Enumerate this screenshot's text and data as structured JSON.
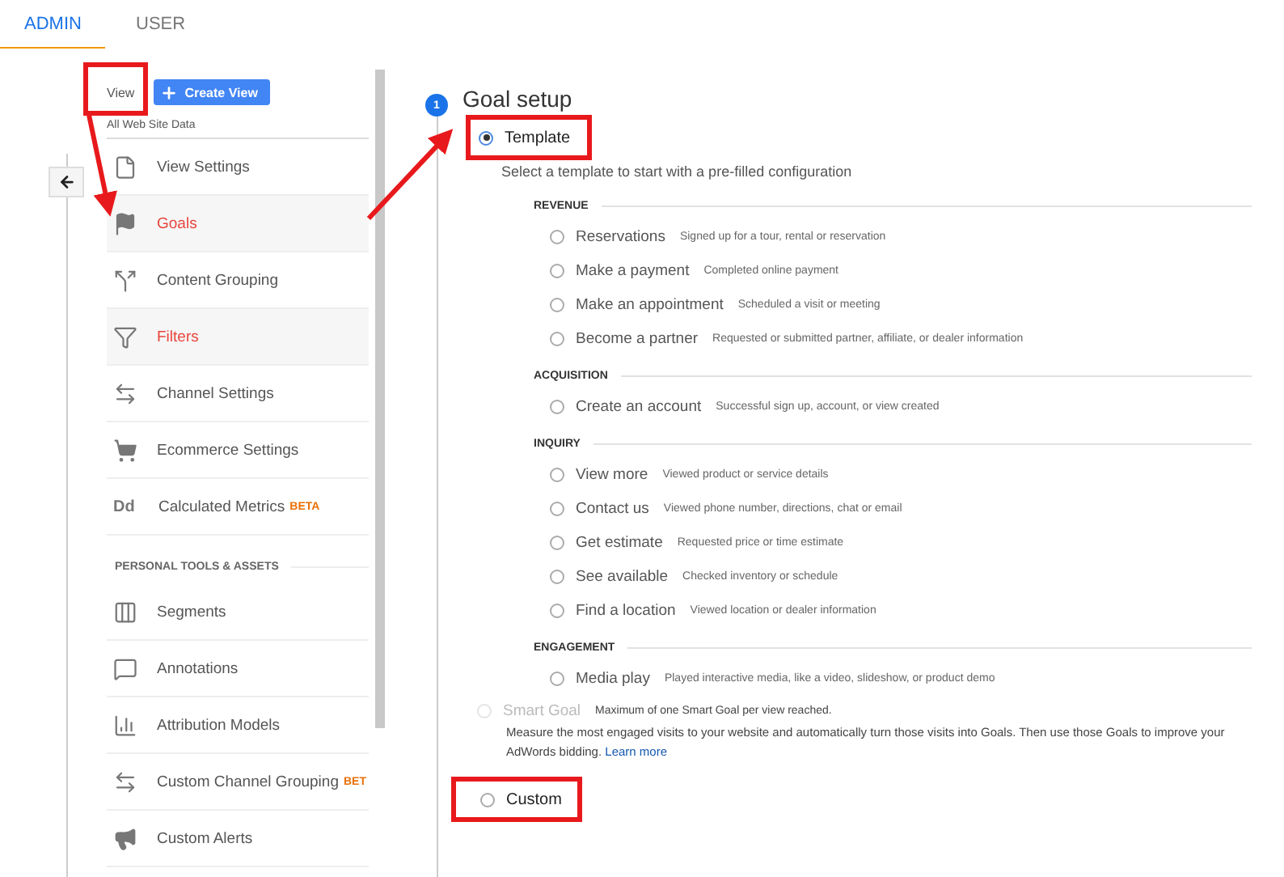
{
  "tabs": [
    {
      "label": "ADMIN",
      "selected": true
    },
    {
      "label": "USER",
      "selected": false
    }
  ],
  "view": {
    "label": "View",
    "annotated": true,
    "create_button": "Create View",
    "name": "All Web Site Data"
  },
  "menu": [
    {
      "label": "View Settings",
      "kind": "page",
      "selected": false
    },
    {
      "label": "Goals",
      "kind": "flag",
      "selected": true
    },
    {
      "label": "Content Grouping",
      "kind": "fork",
      "selected": false
    },
    {
      "label": "Filters",
      "kind": "funnel",
      "selected": true
    },
    {
      "label": "Channel Settings",
      "kind": "arrows",
      "selected": false
    },
    {
      "label": "Ecommerce Settings",
      "kind": "cart",
      "selected": false
    },
    {
      "label": "Calculated Metrics",
      "kind": "letters",
      "icon_text": "Dd",
      "badge": "BETA",
      "selected": false
    }
  ],
  "personal_section": "PERSONAL TOOLS & ASSETS",
  "personal_menu": [
    {
      "label": "Segments",
      "kind": "segments",
      "selected": false
    },
    {
      "label": "Annotations",
      "kind": "bubble",
      "selected": false
    },
    {
      "label": "Attribution Models",
      "kind": "bars",
      "selected": false
    },
    {
      "label": "Custom Channel Grouping",
      "kind": "arrows",
      "badge": "BET",
      "selected": false
    },
    {
      "label": "Custom Alerts",
      "kind": "megaphone",
      "selected": false
    }
  ],
  "goal_setup": {
    "step": "1",
    "title": "Goal setup",
    "template": {
      "label": "Template",
      "selected": true,
      "annotated": true,
      "description": "Select a template to start with a pre-filled configuration"
    },
    "groups": [
      {
        "heading": "REVENUE",
        "options": [
          {
            "label": "Reservations",
            "description": "Signed up for a tour, rental or reservation",
            "selected": false
          },
          {
            "label": "Make a payment",
            "description": "Completed online payment",
            "selected": false
          },
          {
            "label": "Make an appointment",
            "description": "Scheduled a visit or meeting",
            "selected": false
          },
          {
            "label": "Become a partner",
            "description": "Requested or submitted partner, affiliate, or dealer information",
            "selected": false
          }
        ]
      },
      {
        "heading": "ACQUISITION",
        "options": [
          {
            "label": "Create an account",
            "description": "Successful sign up, account, or view created",
            "selected": false
          }
        ]
      },
      {
        "heading": "INQUIRY",
        "options": [
          {
            "label": "View more",
            "description": "Viewed product or service details",
            "selected": false
          },
          {
            "label": "Contact us",
            "description": "Viewed phone number, directions, chat or email",
            "selected": false
          },
          {
            "label": "Get estimate",
            "description": "Requested price or time estimate",
            "selected": false
          },
          {
            "label": "See available",
            "description": "Checked inventory or schedule",
            "selected": false
          },
          {
            "label": "Find a location",
            "description": "Viewed location or dealer information",
            "selected": false
          }
        ]
      },
      {
        "heading": "ENGAGEMENT",
        "options": [
          {
            "label": "Media play",
            "description": "Played interactive media, like a video, slideshow, or product demo",
            "selected": false
          }
        ]
      }
    ],
    "smart_goal": {
      "label": "Smart Goal",
      "disabled": true,
      "note": "Maximum of one Smart Goal per view reached.",
      "description": "Measure the most engaged visits to your website and automatically turn those visits into Goals. Then use those Goals to improve your AdWords bidding.",
      "link": "Learn more"
    },
    "custom": {
      "label": "Custom",
      "selected": false,
      "annotated": true
    }
  }
}
